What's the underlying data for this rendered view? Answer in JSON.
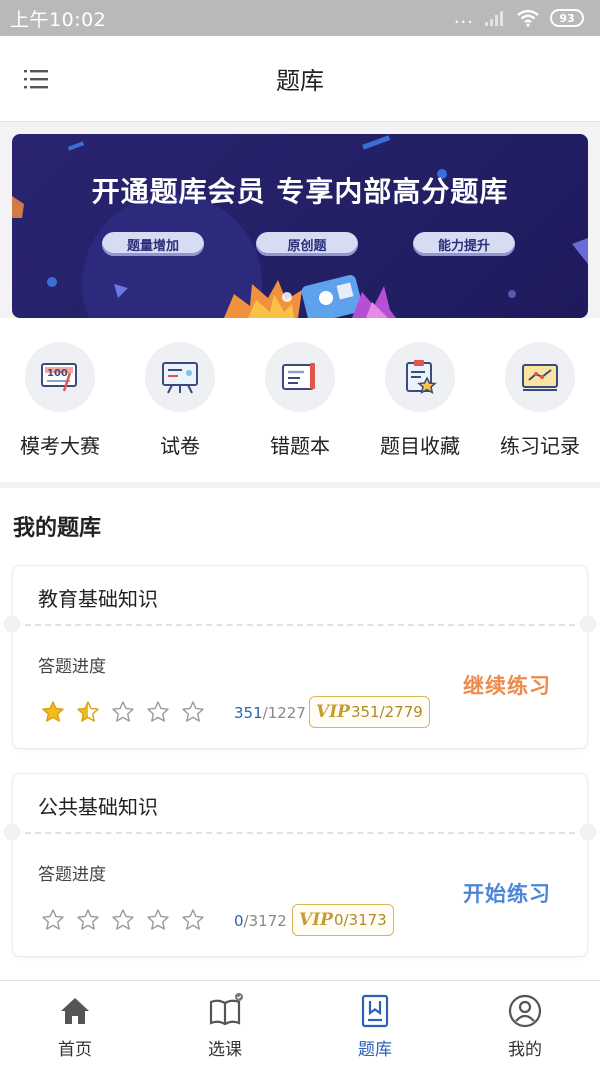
{
  "status_bar": {
    "time": "上午10:02",
    "dots": "...",
    "battery": "93"
  },
  "header": {
    "title": "题库"
  },
  "banner": {
    "title": "开通题库会员  专享内部高分题库",
    "tags": [
      "题量增加",
      "原创题",
      "能力提升"
    ]
  },
  "quick_entries": [
    {
      "label": "模考大赛",
      "icon": "exam-contest-icon"
    },
    {
      "label": "试卷",
      "icon": "test-paper-icon"
    },
    {
      "label": "错题本",
      "icon": "mistake-book-icon"
    },
    {
      "label": "题目收藏",
      "icon": "favorites-icon"
    },
    {
      "label": "练习记录",
      "icon": "practice-record-icon"
    }
  ],
  "library": {
    "title": "我的题库",
    "cards": [
      {
        "title": "教育基础知识",
        "progress_label": "答题进度",
        "rating": 1.5,
        "done": "351",
        "total": "/1227",
        "vip_logo": "VIP",
        "vip_count": "351/2779",
        "action": "继续练习"
      },
      {
        "title": "公共基础知识",
        "progress_label": "答题进度",
        "rating": 0,
        "done": "0",
        "total": "/3172",
        "vip_logo": "VIP",
        "vip_count": "0/3173",
        "action": "开始练习"
      }
    ]
  },
  "bottom_nav": {
    "items": [
      {
        "label": "首页",
        "icon": "home-icon"
      },
      {
        "label": "选课",
        "icon": "book-icon"
      },
      {
        "label": "题库",
        "icon": "question-bank-icon"
      },
      {
        "label": "我的",
        "icon": "profile-icon"
      }
    ],
    "active_index": 2
  },
  "colors": {
    "accent": "#2b62b4",
    "orange": "#f08a4b",
    "gold": "#d7b55a",
    "banner_bg": "#232066"
  }
}
